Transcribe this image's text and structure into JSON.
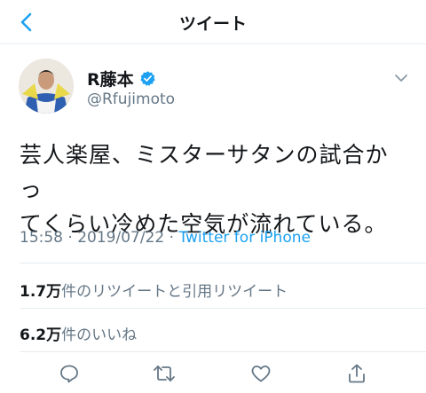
{
  "header": {
    "title": "ツイート"
  },
  "user": {
    "display_name": "R藤本",
    "handle": "@Rfujimoto",
    "verified": true
  },
  "tweet": {
    "text_line1": "芸人楽屋、ミスターサタンの試合かっ",
    "text_line2": "てくらい冷めた空気が流れている。",
    "time": "15:58",
    "separator": "·",
    "date": "2019/07/22",
    "source": "Twitter for iPhone"
  },
  "stats": {
    "retweets_count": "1.7万",
    "retweets_label": "件のリツイートと引用リツイート",
    "likes_count": "6.2万",
    "likes_label": "件のいいね"
  },
  "colors": {
    "accent": "#1da1f2",
    "muted": "#657786",
    "text": "#14171a",
    "divider": "#e6ecf0"
  },
  "icons": {
    "back": "chevron-left-icon",
    "verified": "verified-badge-icon",
    "menu": "chevron-down-icon",
    "reply": "reply-icon",
    "retweet": "retweet-icon",
    "like": "heart-icon",
    "share": "share-icon"
  }
}
